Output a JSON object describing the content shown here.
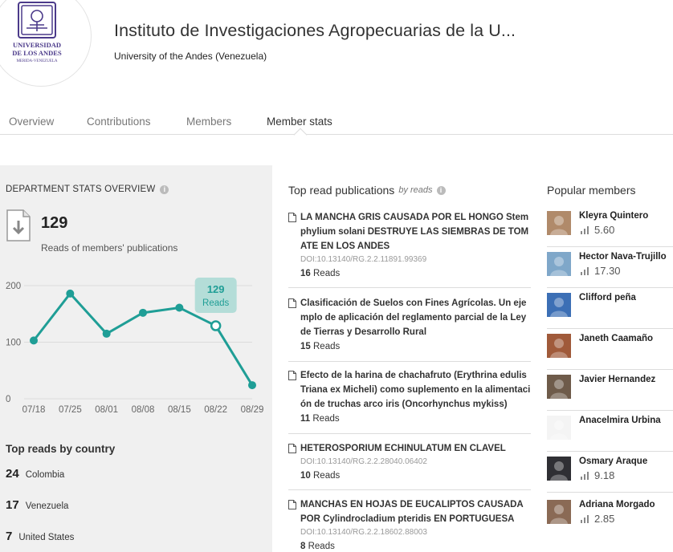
{
  "header": {
    "logo_text": "UNIVERSIDAD DE LOS ANDES MERIDA VENEZUELA",
    "title": "Instituto de Investigaciones Agropecuarias de la U...",
    "subtitle": "University of the Andes (Venezuela)"
  },
  "tabs": [
    {
      "label": "Overview"
    },
    {
      "label": "Contributions"
    },
    {
      "label": "Members"
    },
    {
      "label": "Member stats"
    }
  ],
  "stats": {
    "section_title": "DEPARTMENT STATS OVERVIEW",
    "reads_count": "129",
    "reads_label": "Reads of members' publications",
    "tooltip_value": "129",
    "tooltip_label": "Reads"
  },
  "chart_data": {
    "type": "line",
    "x": [
      "07/18",
      "07/25",
      "08/01",
      "08/08",
      "08/15",
      "08/22",
      "08/29"
    ],
    "values": [
      103,
      186,
      115,
      152,
      161,
      129,
      24
    ],
    "ylim": [
      0,
      200
    ],
    "yticks": [
      "0",
      "100",
      "200"
    ],
    "highlight_index": 5,
    "line_color": "#1f9e96",
    "grid": true
  },
  "countries": {
    "title": "Top reads by country",
    "items": [
      {
        "count": "24",
        "name": "Colombia"
      },
      {
        "count": "17",
        "name": "Venezuela"
      },
      {
        "count": "7",
        "name": "United States"
      }
    ]
  },
  "publications": {
    "title": "Top read publications",
    "by_label": "by reads",
    "items": [
      {
        "title": "LA MANCHA GRIS CAUSADA POR EL HONGO Stemphylium solani DESTRUYE LAS SIEMBRAS DE TOMATE EN LOS ANDES",
        "doi": "DOI:10.13140/RG.2.2.11891.99369",
        "reads": "16",
        "reads_label": "Reads"
      },
      {
        "title": "Clasificación de Suelos con Fines Agrícolas. Un ejemplo de aplicación del reglamento parcial de la Ley de Tierras y Desarrollo Rural",
        "doi": "",
        "reads": "15",
        "reads_label": "Reads"
      },
      {
        "title": "Efecto de la harina de chachafruto (Erythrina edulis Triana ex Micheli) como suplemento en la alimentación de truchas arco iris (Oncorhynchus mykiss)",
        "doi": "",
        "reads": "11",
        "reads_label": "Reads"
      },
      {
        "title": "HETEROSPORIUM ECHINULATUM EN CLAVEL",
        "doi": "DOI:10.13140/RG.2.2.28040.06402",
        "reads": "10",
        "reads_label": "Reads"
      },
      {
        "title": "MANCHAS EN HOJAS DE EUCALIPTOS CAUSADA POR Cylindrocladium pteridis EN PORTUGUESA",
        "doi": "DOI:10.13140/RG.2.2.18602.88003",
        "reads": "8",
        "reads_label": "Reads"
      }
    ]
  },
  "members": {
    "title": "Popular members",
    "items": [
      {
        "name": "Kleyra Quintero",
        "score": "5.60",
        "avatar_color": "#b08a6a"
      },
      {
        "name": "Hector Nava-Trujillo",
        "score": "17.30",
        "avatar_color": "#7fa7c9"
      },
      {
        "name": "Clifford peña",
        "score": "",
        "avatar_color": "#3c6fb5"
      },
      {
        "name": "Janeth Caamaño",
        "score": "",
        "avatar_color": "#a05a3a"
      },
      {
        "name": "Javier Hernandez",
        "score": "",
        "avatar_color": "#6e5b4a"
      },
      {
        "name": "Anacelmira Urbina",
        "score": "",
        "avatar_color": "#f4f4f4"
      },
      {
        "name": "Osmary Araque",
        "score": "9.18",
        "avatar_color": "#2f2f34"
      },
      {
        "name": "Adriana Morgado",
        "score": "2.85",
        "avatar_color": "#8a6a55"
      }
    ]
  }
}
